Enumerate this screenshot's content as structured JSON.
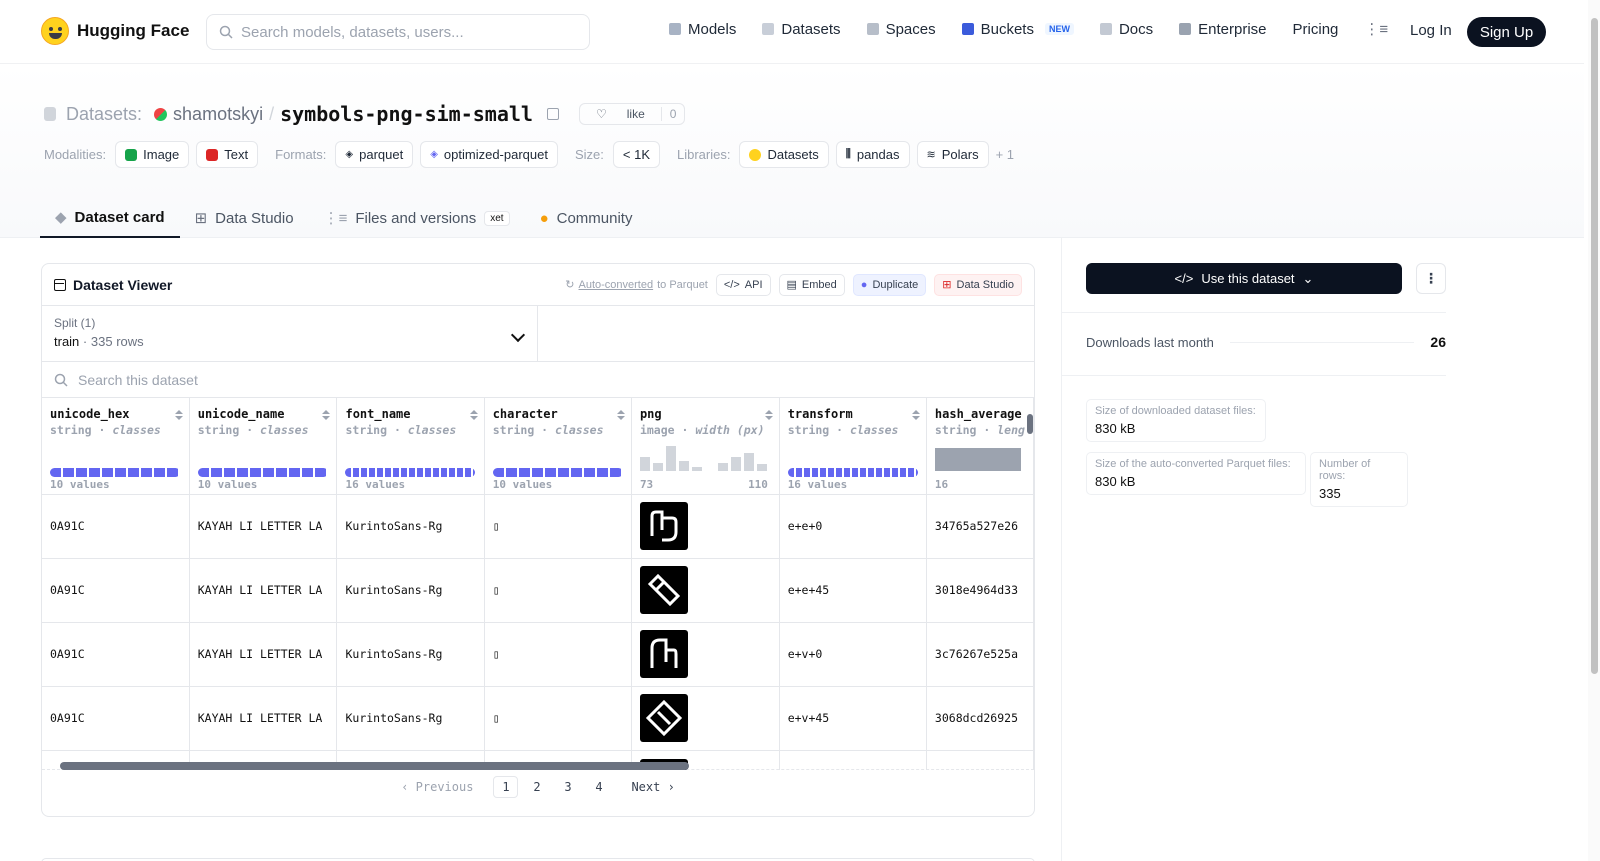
{
  "header": {
    "brand": "Hugging Face",
    "search_placeholder": "Search models, datasets, users...",
    "nav": [
      {
        "label": "Models",
        "color": "#a8b3c4"
      },
      {
        "label": "Datasets",
        "color": "#c8ced8"
      },
      {
        "label": "Spaces",
        "color": "#b7bec9"
      },
      {
        "label": "Buckets",
        "color": "#3b5bdb",
        "badge": "NEW"
      },
      {
        "label": "Docs",
        "color": "#c3c9d3"
      },
      {
        "label": "Enterprise",
        "color": "#9aa3b0"
      },
      {
        "label": "Pricing"
      }
    ],
    "login": "Log In",
    "signup": "Sign Up"
  },
  "repo": {
    "prefix": "Datasets:",
    "owner": "shamotskyi",
    "sep": "/",
    "name": "symbols-png-sim-small",
    "like_label": "like",
    "like_count": "0"
  },
  "meta": {
    "modalities_label": "Modalities:",
    "modalities": [
      "Image",
      "Text"
    ],
    "formats_label": "Formats:",
    "formats": [
      "parquet",
      "optimized-parquet"
    ],
    "size_label": "Size:",
    "size": "< 1K",
    "libraries_label": "Libraries:",
    "libraries": [
      "Datasets",
      "pandas",
      "Polars"
    ],
    "more": "+ 1"
  },
  "tabs": {
    "card": "Dataset card",
    "studio": "Data Studio",
    "files": "Files and versions",
    "xet": "xet",
    "community": "Community"
  },
  "viewer": {
    "title": "Dataset Viewer",
    "auto_converted": "Auto-converted",
    "to_parquet": "to Parquet",
    "api": "API",
    "embed": "Embed",
    "duplicate": "Duplicate",
    "data_studio": "Data Studio",
    "split_label": "Split (1)",
    "split_name": "train",
    "split_rows": "335 rows",
    "search_placeholder": "Search this dataset",
    "columns": [
      {
        "name": "unicode_hex",
        "type": "string",
        "kind": "classes",
        "foot": "10 values"
      },
      {
        "name": "unicode_name",
        "type": "string",
        "kind": "classes",
        "foot": "10 values"
      },
      {
        "name": "font_name",
        "type": "string",
        "kind": "classes",
        "foot": "16 values"
      },
      {
        "name": "character",
        "type": "string",
        "kind": "classes",
        "foot": "10 values"
      },
      {
        "name": "png",
        "type": "image",
        "kind": "width (px)",
        "foot_min": "73",
        "foot_max": "110"
      },
      {
        "name": "transform",
        "type": "string",
        "kind": "classes",
        "foot": "16 values"
      },
      {
        "name": "hash_average",
        "type": "string",
        "kind": "leng",
        "foot": "16"
      }
    ],
    "rows": [
      {
        "unicode_hex": "0A91C",
        "unicode_name": "KAYAH LI LETTER LA",
        "font_name": "KurintoSans-Rg",
        "character": "▯",
        "transform": "e+e+0",
        "hash_average": "34765a527e26"
      },
      {
        "unicode_hex": "0A91C",
        "unicode_name": "KAYAH LI LETTER LA",
        "font_name": "KurintoSans-Rg",
        "character": "▯",
        "transform": "e+e+45",
        "hash_average": "3018e4964d33"
      },
      {
        "unicode_hex": "0A91C",
        "unicode_name": "KAYAH LI LETTER LA",
        "font_name": "KurintoSans-Rg",
        "character": "▯",
        "transform": "e+v+0",
        "hash_average": "3c76267e525a"
      },
      {
        "unicode_hex": "0A91C",
        "unicode_name": "KAYAH LI LETTER LA",
        "font_name": "KurintoSans-Rg",
        "character": "▯",
        "transform": "e+v+45",
        "hash_average": "3068dcd26925"
      }
    ],
    "pager": {
      "prev": "Previous",
      "pages": [
        "1",
        "2",
        "3",
        "4"
      ],
      "current": "1",
      "next": "Next"
    }
  },
  "sidebar": {
    "use_dataset": "Use this dataset",
    "downloads_label": "Downloads last month",
    "downloads_value": "26",
    "size_dl_label": "Size of downloaded dataset files:",
    "size_dl_value": "830 kB",
    "size_parquet_label": "Size of the auto-converted Parquet files:",
    "size_parquet_value": "830 kB",
    "num_rows_label": "Number of rows:",
    "num_rows_value": "335"
  }
}
